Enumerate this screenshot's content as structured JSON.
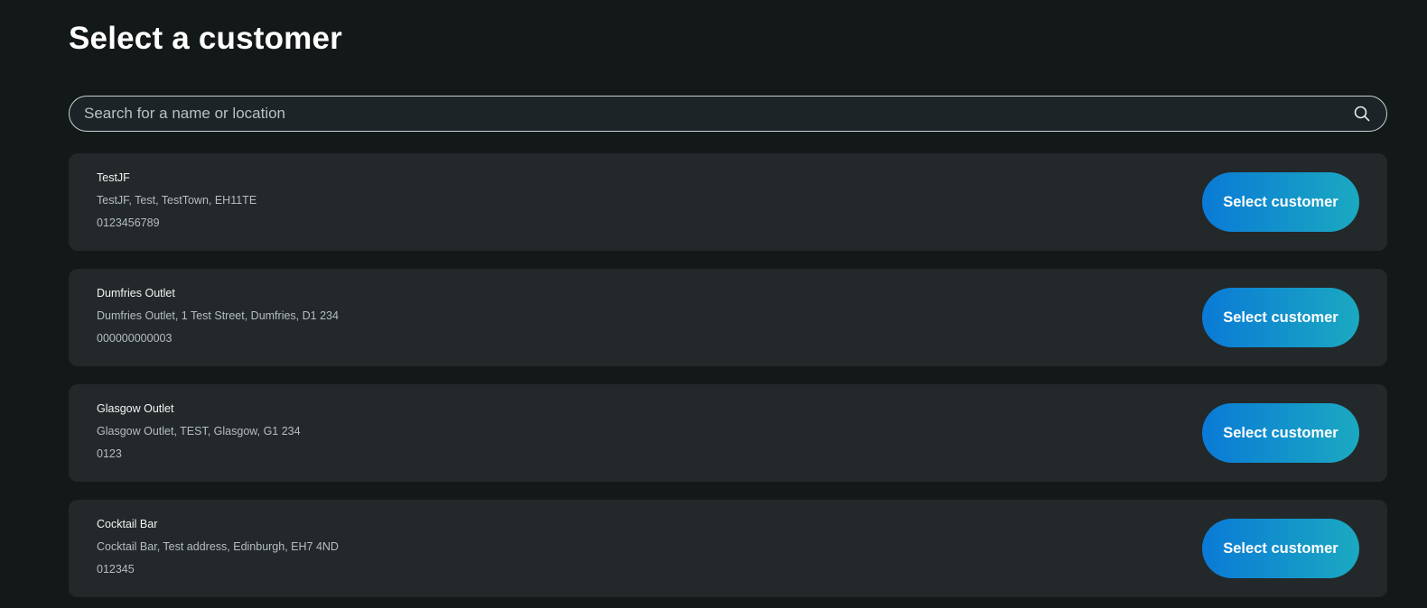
{
  "page": {
    "title": "Select a customer"
  },
  "search": {
    "placeholder": "Search for a name or location",
    "value": "",
    "icon": "search-icon"
  },
  "customers": [
    {
      "name": "TestJF",
      "address": "TestJF, Test, TestTown, EH11TE",
      "phone": "0123456789",
      "button_label": "Select customer"
    },
    {
      "name": "Dumfries Outlet",
      "address": "Dumfries Outlet, 1 Test Street, Dumfries, D1 234",
      "phone": "000000000003",
      "button_label": "Select customer"
    },
    {
      "name": "Glasgow Outlet",
      "address": "Glasgow Outlet, TEST, Glasgow, G1 234",
      "phone": "0123",
      "button_label": "Select customer"
    },
    {
      "name": "Cocktail Bar",
      "address": "Cocktail Bar, Test address, Edinburgh, EH7 4ND",
      "phone": "012345",
      "button_label": "Select customer"
    }
  ],
  "colors": {
    "background": "#131819",
    "card": "#23282a",
    "button_gradient_start": "#0a7ad6",
    "button_gradient_end": "#1ba9c1"
  }
}
